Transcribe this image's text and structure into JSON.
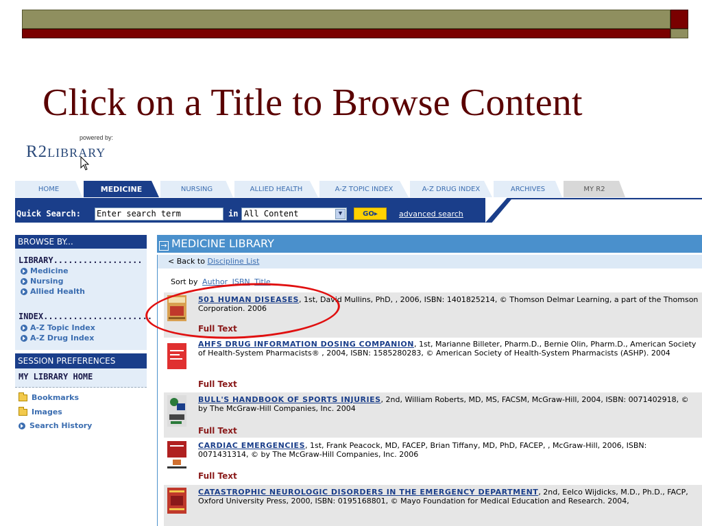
{
  "slide": {
    "title": "Click on a Title to Browse Content",
    "colors": {
      "olive": "#8f8f5f",
      "maroon": "#7a0000",
      "title": "#5a0000"
    }
  },
  "logo": {
    "powered_by": "powered by:",
    "brand": "R2 Library"
  },
  "tabs": [
    {
      "label": "HOME",
      "state": "inactive"
    },
    {
      "label": "MEDICINE",
      "state": "active"
    },
    {
      "label": "NURSING",
      "state": "inactive"
    },
    {
      "label": "ALLIED HEALTH",
      "state": "inactive"
    },
    {
      "label": "A-Z TOPIC INDEX",
      "state": "inactive"
    },
    {
      "label": "A-Z DRUG INDEX",
      "state": "inactive"
    },
    {
      "label": "ARCHIVES",
      "state": "inactive"
    },
    {
      "label": "MY R2",
      "state": "inactive"
    }
  ],
  "search": {
    "label": "Quick Search:",
    "input_value": "Enter search term",
    "in_label": "in",
    "scope_selected": "All Content",
    "go_label": "GO▸",
    "advanced_label": "advanced search"
  },
  "sidebar": {
    "browse_header": "BROWSE BY...",
    "library_label": "LIBRARY..................",
    "library_items": [
      "Medicine",
      "Nursing",
      "Allied Health"
    ],
    "index_label": "INDEX......................",
    "index_items": [
      "A-Z Topic Index",
      "A-Z Drug Index"
    ],
    "session_header": "SESSION PREFERENCES",
    "home_label": "MY LIBRARY HOME",
    "bookmarks": "Bookmarks",
    "images": "Images",
    "history": "Search History"
  },
  "main": {
    "header": "MEDICINE LIBRARY",
    "back_prefix": "< Back to ",
    "back_link": "Discipline List",
    "sort_prefix": "Sort by",
    "sort_author": "Author",
    "sort_isbn": "ISBN",
    "sort_title": "Title",
    "full_text": "Full Text",
    "books": [
      {
        "title": "501 HUMAN DISEASES",
        "details": ", 1st, David Mullins, PhD, , 2006, ISBN: 1401825214, © Thomson Delmar Learning, a part of the Thomson Corporation. 2006"
      },
      {
        "title": "AHFS DRUG INFORMATION DOSING COMPANION",
        "details": ", 1st, Marianne Billeter, Pharm.D., Bernie Olin, Pharm.D., American Society of Health-System Pharmacists® , 2004, ISBN: 1585280283, © American Society of Health-System Pharmacists (ASHP). 2004"
      },
      {
        "title": "BULL'S HANDBOOK OF SPORTS INJURIES",
        "details": ", 2nd, William Roberts, MD, MS, FACSM, McGraw-Hill, 2004, ISBN: 0071402918, © by The McGraw-Hill Companies, Inc. 2004"
      },
      {
        "title": "CARDIAC EMERGENCIES",
        "details": ", 1st, Frank Peacock, MD, FACEP, Brian Tiffany, MD, PhD, FACEP, , McGraw-Hill, 2006, ISBN: 0071431314, © by The McGraw-Hill Companies, Inc. 2006"
      },
      {
        "title": "CATASTROPHIC NEUROLOGIC DISORDERS IN THE EMERGENCY DEPARTMENT",
        "details": ", 2nd, Eelco Wijdicks, M.D., Ph.D., FACP, Oxford University Press, 2000, ISBN: 0195168801, © Mayo Foundation for Medical Education and Research. 2004,"
      }
    ]
  }
}
